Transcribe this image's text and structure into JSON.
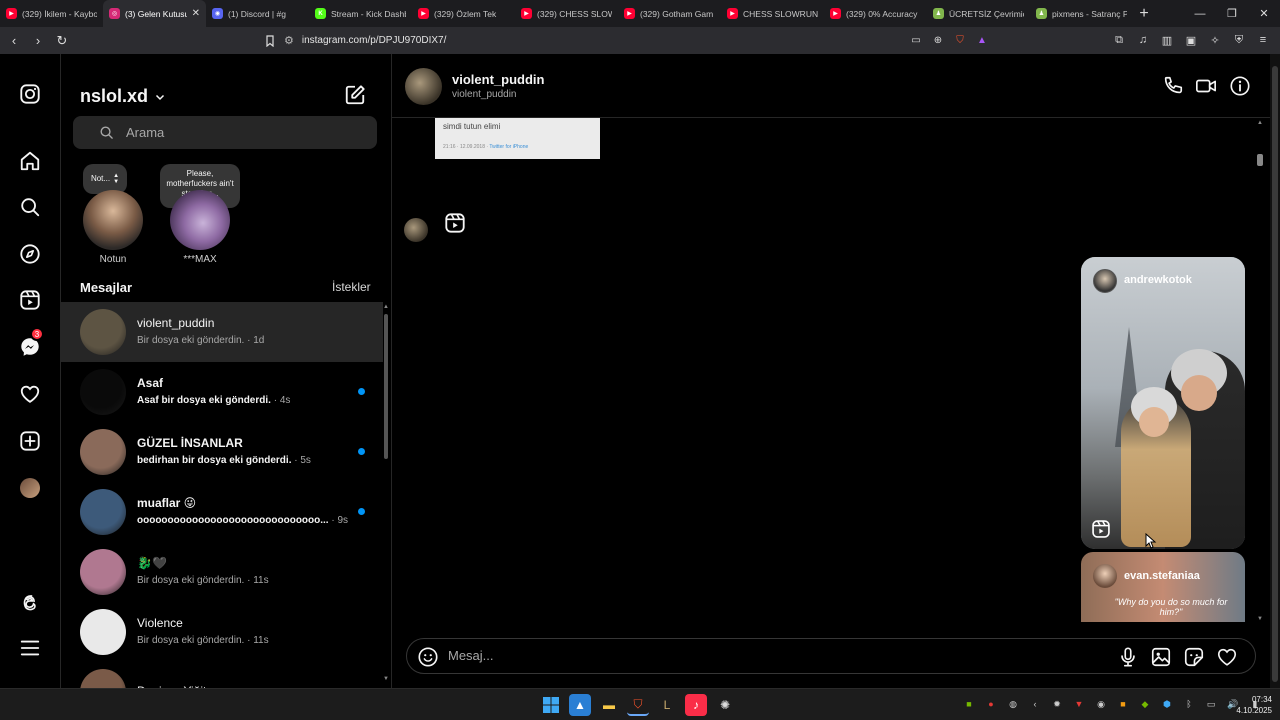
{
  "browser": {
    "tabs": [
      {
        "title": "(329) İkilem - Kaybo",
        "icon": "youtube-icon",
        "color": "#ff0033",
        "active": false
      },
      {
        "title": "(3) Gelen Kutusu",
        "icon": "instagram-icon",
        "color": "#d62976",
        "active": true
      },
      {
        "title": "(1) Discord | #g",
        "icon": "discord-icon",
        "color": "#5865f2",
        "active": false
      },
      {
        "title": "Stream - Kick Dashb",
        "icon": "kick-icon",
        "color": "#53fc18",
        "active": false
      },
      {
        "title": "(329) Özlem Tek",
        "icon": "youtube-icon",
        "color": "#ff0033",
        "active": false
      },
      {
        "title": "(329) CHESS SLOW",
        "icon": "youtube-icon",
        "color": "#ff0033",
        "active": false
      },
      {
        "title": "(329) Gotham Gam",
        "icon": "youtube-icon",
        "color": "#ff0033",
        "active": false
      },
      {
        "title": "CHESS SLOWRUN |",
        "icon": "youtube-icon",
        "color": "#ff0033",
        "active": false
      },
      {
        "title": "(329) 0% Accuracy",
        "icon": "youtube-icon",
        "color": "#ff0033",
        "active": false
      },
      {
        "title": "ÜCRETSİZ Çevrimiç",
        "icon": "chess-pawn-icon",
        "color": "#81b64c",
        "active": false
      },
      {
        "title": "pixmens - Satranç P",
        "icon": "chess-pawn-icon",
        "color": "#81b64c",
        "active": false
      }
    ],
    "new_tab": "+",
    "url": "instagram.com/p/DPJU970DIX7/"
  },
  "inbox": {
    "account": "nslol.xd",
    "search_placeholder": "Arama",
    "notes": [
      {
        "bubble": "Not...",
        "name": "Notun"
      },
      {
        "bubble": "Please, motherfuckers ain't stopping...",
        "name": "***MAX"
      }
    ],
    "section_title": "Mesajlar",
    "requests_label": "İstekler",
    "threads": [
      {
        "name": "violent_puddin",
        "sub": "Bir dosya eki gönderdin.",
        "time": "1d",
        "unread": false,
        "active": true,
        "avatar": "#5d5443"
      },
      {
        "name": "Asaf",
        "sub": "Asaf bir dosya eki gönderdi.",
        "time": "4s",
        "unread": true,
        "active": false,
        "avatar": "#0a0a0a"
      },
      {
        "name": "GÜZEL İNSANLAR",
        "sub": "bedirhan bir dosya eki gönderdi.",
        "time": "5s",
        "unread": true,
        "active": false,
        "avatar": "#8a6a5a"
      },
      {
        "name": "muaflar 😜",
        "sub": "oooooooooooooooooooooooooooooo...",
        "time": "9s",
        "unread": true,
        "active": false,
        "avatar": "#3d5a7a"
      },
      {
        "name": "🐉🖤",
        "sub": "Bir dosya eki gönderdin.",
        "time": "11s",
        "unread": false,
        "active": false,
        "avatar": "#b07890"
      },
      {
        "name": "Violence",
        "sub": "Bir dosya eki gönderdin.",
        "time": "11s",
        "unread": false,
        "active": false,
        "avatar": "#e9e9e9"
      },
      {
        "name": "Denizay Yiğit",
        "sub": "",
        "time": "",
        "unread": false,
        "active": false,
        "avatar": "#7a5a48"
      }
    ],
    "messages_badge": "3"
  },
  "chat": {
    "name": "violent_puddin",
    "username": "violent_puddin",
    "tweet_text": "simdi tutun elimi",
    "tweet_time": "21:16 · 12.09.2018 ·",
    "tweet_source": "Twitter for iPhone",
    "reel1_user": "andrewkotok",
    "reel2_user": "evan.stefaniaa",
    "reel2_caption": "\"Why do you do so much for him?\"",
    "composer_placeholder": "Mesaj..."
  },
  "taskbar": {
    "time": "07:34",
    "date": "4.10.2025"
  }
}
